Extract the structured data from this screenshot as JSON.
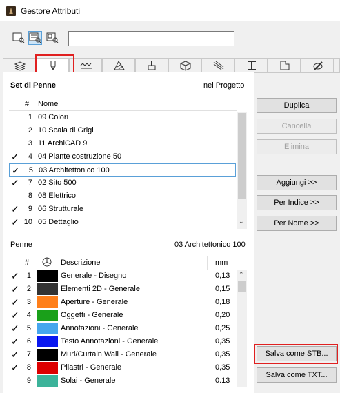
{
  "window": {
    "title": "Gestore Attributi"
  },
  "view_buttons": [
    "list-view-icon",
    "details-view-icon",
    "preview-view-icon"
  ],
  "search": {
    "value": "",
    "placeholder": ""
  },
  "tabs": [
    "layers-icon",
    "pen-icon",
    "line-type-icon",
    "fill-icon",
    "paint-icon",
    "building-material-icon",
    "composite-icon",
    "profile-icon",
    "zone-icon",
    "surface-icon",
    "more-icon"
  ],
  "pen_sets": {
    "label": "Set di Penne",
    "scope": "nel Progetto",
    "columns": {
      "num": "#",
      "name": "Nome"
    },
    "rows": [
      {
        "check": "",
        "num": "1",
        "name": "09 Colori"
      },
      {
        "check": "",
        "num": "2",
        "name": "10 Scala di Grigi"
      },
      {
        "check": "",
        "num": "3",
        "name": "11 ArchiCAD 9"
      },
      {
        "check": "✓",
        "num": "4",
        "name": "04 Piante costruzione 50"
      },
      {
        "check": "✓",
        "num": "5",
        "name": "03 Architettonico 100"
      },
      {
        "check": "✓",
        "num": "7",
        "name": "02 Sito 500"
      },
      {
        "check": "",
        "num": "8",
        "name": "08 Elettrico"
      },
      {
        "check": "✓",
        "num": "9",
        "name": "06 Strutturale"
      },
      {
        "check": "✓",
        "num": "10",
        "name": "05 Dettaglio"
      }
    ]
  },
  "pens": {
    "label": "Penne",
    "current_set": "03 Architettonico 100",
    "columns": {
      "num": "#",
      "desc": "Descrizione",
      "mm": "mm"
    },
    "rows": [
      {
        "check": "✓",
        "num": "1",
        "color": "#000000",
        "desc": "Generale - Disegno",
        "mm": "0,13"
      },
      {
        "check": "✓",
        "num": "2",
        "color": "#333333",
        "desc": "Elementi 2D - Generale",
        "mm": "0,15"
      },
      {
        "check": "✓",
        "num": "3",
        "color": "#ff7f1a",
        "desc": "Aperture - Generale",
        "mm": "0,18"
      },
      {
        "check": "✓",
        "num": "4",
        "color": "#1aa01a",
        "desc": "Oggetti - Generale",
        "mm": "0,20"
      },
      {
        "check": "✓",
        "num": "5",
        "color": "#46a6ee",
        "desc": "Annotazioni - Generale",
        "mm": "0,25"
      },
      {
        "check": "✓",
        "num": "6",
        "color": "#0a17f0",
        "desc": "Testo Annotazioni  - Generale",
        "mm": "0,35"
      },
      {
        "check": "✓",
        "num": "7",
        "color": "#000000",
        "desc": "Muri/Curtain Wall - Generale",
        "mm": "0,35"
      },
      {
        "check": "✓",
        "num": "8",
        "color": "#dd0000",
        "desc": "Pilastri - Generale",
        "mm": "0,35"
      },
      {
        "check": "",
        "num": "9",
        "color": "#3cb39a",
        "desc": "Solai - Generale",
        "mm": "0.13"
      }
    ]
  },
  "buttons": {
    "duplica": "Duplica",
    "cancella": "Cancella",
    "elimina": "Elimina",
    "aggiungi": "Aggiungi >>",
    "per_indice": "Per Indice >>",
    "per_nome": "Per Nome >>",
    "salva_stb": "Salva come STB...",
    "salva_txt": "Salva come TXT..."
  },
  "colors": {
    "accent": "#5aa0d8",
    "highlight": "#e02020"
  }
}
